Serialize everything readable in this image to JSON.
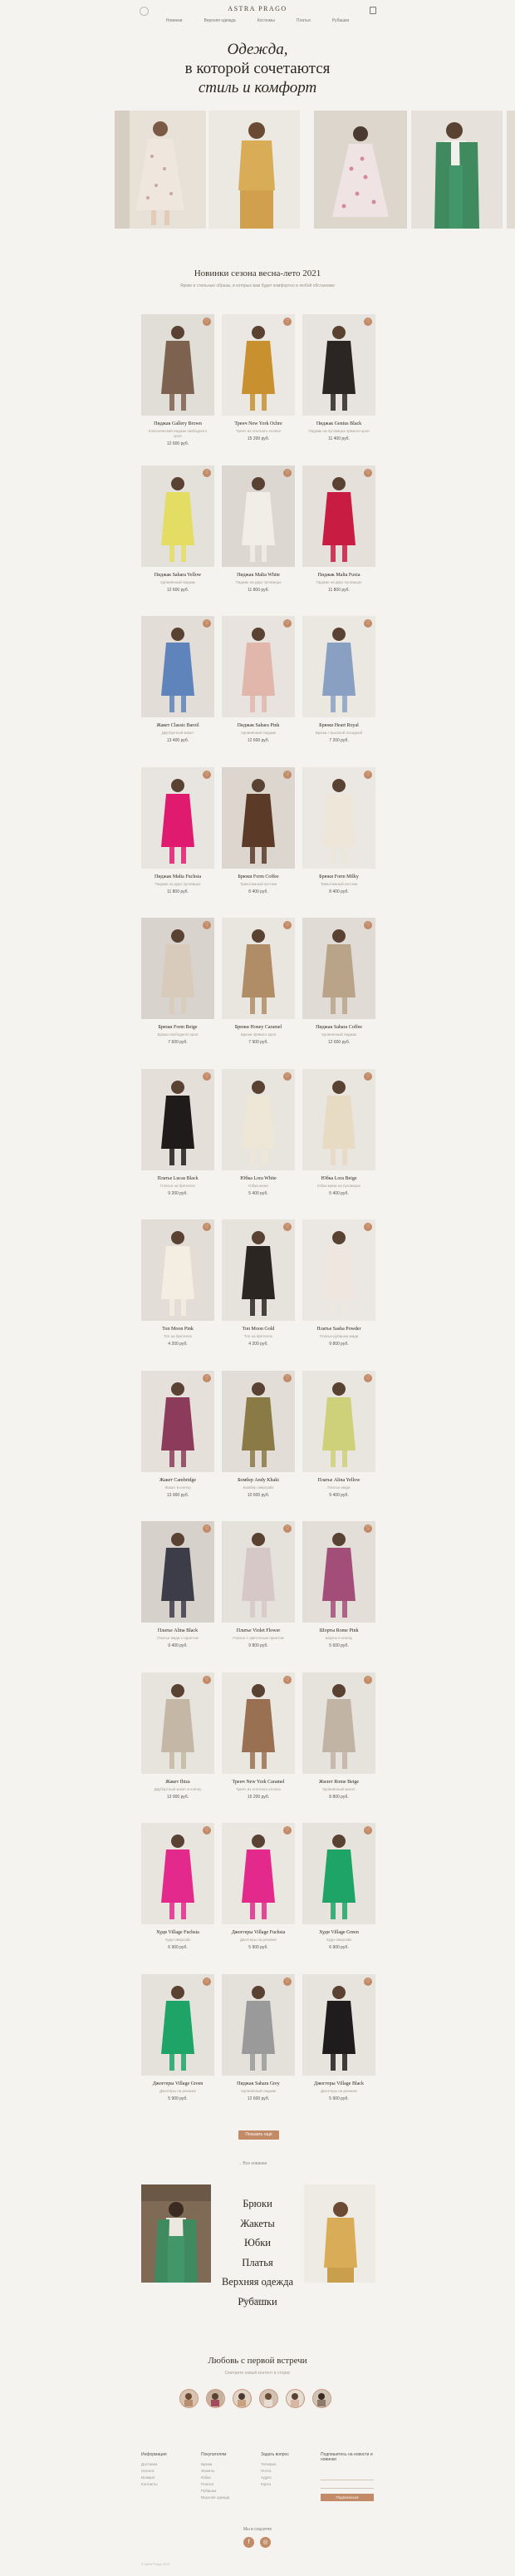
{
  "header": {
    "logo": "ASTRA PRAGO",
    "nav": [
      "Новинки",
      "Верхняя одежда",
      "Костюмы",
      "Платья",
      "Рубашки"
    ]
  },
  "hero": {
    "title_line1": "Одежда,",
    "title_line2": "в которой сочетаются",
    "title_line3": "стиль и комфорт"
  },
  "new_arrivals": {
    "title": "Новинки сезона весна-лето 2021",
    "subtitle": "Яркие и стильные образы, в которых вам будет комфортно в любой обстановке"
  },
  "products": [
    {
      "name": "Пиджак Gallery Brown",
      "desc": "Классический пиджак свободного кроя",
      "price": "12 600 руб."
    },
    {
      "name": "Тренч New York Ochre",
      "desc": "Тренч из плотного хлопка",
      "price": "15 200 руб."
    },
    {
      "name": "Пиджак Genius Black",
      "desc": "Пиджак на пуговицах прямого кроя",
      "price": "11 400 руб."
    },
    {
      "name": "Пиджак Sahara Yellow",
      "desc": "Удлинённый пиджак",
      "price": "12 600 руб."
    },
    {
      "name": "Пиджак Malta White",
      "desc": "Пиджак на двух пуговицах",
      "price": "11 800 руб."
    },
    {
      "name": "Пиджак Malta Fuxia",
      "desc": "Пиджак на двух пуговицах",
      "price": "11 800 руб."
    },
    {
      "name": "Жакет Classic Baroil",
      "desc": "Двубортный жакет",
      "price": "13 400 руб."
    },
    {
      "name": "Пиджак Sahara Pink",
      "desc": "Удлинённый пиджак",
      "price": "12 600 руб."
    },
    {
      "name": "Брюки Heart Royal",
      "desc": "Брюки с высокой посадкой",
      "price": "7 200 руб."
    },
    {
      "name": "Пиджак Malta Fuchsia",
      "desc": "Пиджак на двух пуговицах",
      "price": "11 800 руб."
    },
    {
      "name": "Брюки Form Coffee",
      "desc": "Трикотажный костюм",
      "price": "8 400 руб."
    },
    {
      "name": "Брюки Form Milky",
      "desc": "Трикотажный костюм",
      "price": "8 400 руб."
    },
    {
      "name": "Брюки Form Beige",
      "desc": "Брюки свободного кроя",
      "price": "7 600 руб."
    },
    {
      "name": "Брюки Honey Caramel",
      "desc": "Брюки прямого кроя",
      "price": "7 900 руб."
    },
    {
      "name": "Пиджак Sahara Coffee",
      "desc": "Удлинённый пиджак",
      "price": "12 600 руб."
    },
    {
      "name": "Платье Lucas Black",
      "desc": "Платье на бретелях",
      "price": "9 200 руб."
    },
    {
      "name": "Юбка Lora White",
      "desc": "Юбка мини",
      "price": "5 400 руб."
    },
    {
      "name": "Юбка Lora Beige",
      "desc": "Юбка мини на пуговицах",
      "price": "5 400 руб."
    },
    {
      "name": "Топ Moon Pink",
      "desc": "Топ на бретелях",
      "price": "4 200 руб."
    },
    {
      "name": "Топ Moon Gold",
      "desc": "Топ на бретелях",
      "price": "4 200 руб."
    },
    {
      "name": "Платье Sasha Powder",
      "desc": "Платье-рубашка миди",
      "price": "9 800 руб."
    },
    {
      "name": "Жакет Cambridge",
      "desc": "Жакет в клетку",
      "price": "13 900 руб."
    },
    {
      "name": "Бомбер Andy Khaki",
      "desc": "Бомбер оверсайз",
      "price": "10 600 руб."
    },
    {
      "name": "Платье Alina Yellow",
      "desc": "Платье миди",
      "price": "9 400 руб."
    },
    {
      "name": "Платье Alina Black",
      "desc": "Платье миди с принтом",
      "price": "9 400 руб."
    },
    {
      "name": "Платье Violet Flower",
      "desc": "Платье с цветочным принтом",
      "price": "9 800 руб."
    },
    {
      "name": "Шорты Rome Pink",
      "desc": "Шорты в клетку",
      "price": "5 600 руб."
    },
    {
      "name": "Жакет Ibiza",
      "desc": "Двубортный жакет в клетку",
      "price": "13 900 руб."
    },
    {
      "name": "Тренч New York Caramel",
      "desc": "Тренч из плотного хлопка",
      "price": "15 200 руб."
    },
    {
      "name": "Жилет Rome Beige",
      "desc": "Удлинённый жилет",
      "price": "8 800 руб."
    },
    {
      "name": "Худи Village Fuchsia",
      "desc": "Худи оверсайз",
      "price": "6 900 руб."
    },
    {
      "name": "Джоггеры Village Fuchsia",
      "desc": "Джоггеры на резинке",
      "price": "5 900 руб."
    },
    {
      "name": "Худи Village Green",
      "desc": "Худи оверсайз",
      "price": "6 900 руб."
    },
    {
      "name": "Джоггеры Village Green",
      "desc": "Джоггеры на резинке",
      "price": "5 900 руб."
    },
    {
      "name": "Пиджак Sahara Grey",
      "desc": "Удлинённый пиджак",
      "price": "12 600 руб."
    },
    {
      "name": "Джоггеры Village Black",
      "desc": "Джоггеры на резинке",
      "price": "5 900 руб."
    }
  ],
  "more_button": "Показать ещё",
  "all_link": "→ Все новинки",
  "categories": [
    "Брюки",
    "Жакеты",
    "Юбки",
    "Платья",
    "Верхняя одежда",
    "Рубашки"
  ],
  "categories_link": "→ Все новинки",
  "love": {
    "title": "Любовь с первой встречи",
    "subtitle": "Смотрите новый контент в сторис"
  },
  "footer": {
    "col1_title": "Информация",
    "col1": [
      "Доставка",
      "Оплата",
      "Возврат",
      "Контакты"
    ],
    "col2_title": "Покупателям",
    "col2": [
      "Брюки",
      "Жакеты",
      "Юбки",
      "Платья",
      "Рубашки",
      "Верхняя одежда"
    ],
    "col3_title": "Задать вопрос",
    "col3": [
      "Телефон",
      "Почта",
      "Адрес",
      "Карта"
    ],
    "col4_title": "Подпишитесь на новости и новинки",
    "subscribe_btn": "Подписаться",
    "social_title": "Мы в соцсетях",
    "copyright": "© Astra Prago 2021"
  },
  "colors": {
    "background": "#f5f3ef",
    "accent": "#c28a66",
    "text": "#2d2620"
  }
}
